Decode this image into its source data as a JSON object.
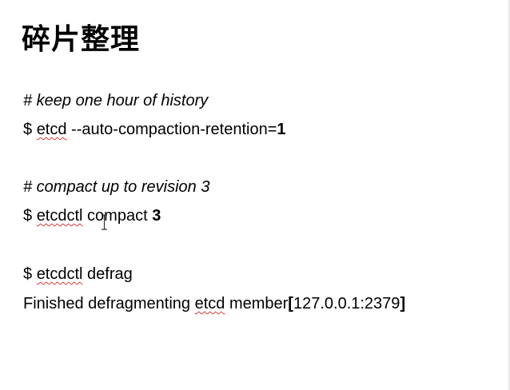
{
  "slide": {
    "title": "碎片整理",
    "lines": {
      "comment1": "# keep one hour of history",
      "cmd1_prompt": "$ ",
      "cmd1_bin": "etcd",
      "cmd1_args": " --auto-compaction-retention=",
      "cmd1_value": "1",
      "comment2": "# compact up to revision 3",
      "cmd2_prompt": "$ ",
      "cmd2_bin": "etcdctl",
      "cmd2_args": " compact ",
      "cmd2_value": "3",
      "cmd3_prompt": "$ ",
      "cmd3_bin": "etcdctl",
      "cmd3_args": " defrag",
      "output_prefix": "Finished defragmenting ",
      "output_bin": "etcd",
      "output_mid": " member",
      "output_open": "[",
      "output_addr": "127.0.0.1:2379",
      "output_close": "]"
    }
  },
  "icons": {
    "cursor": "text-cursor-icon"
  }
}
